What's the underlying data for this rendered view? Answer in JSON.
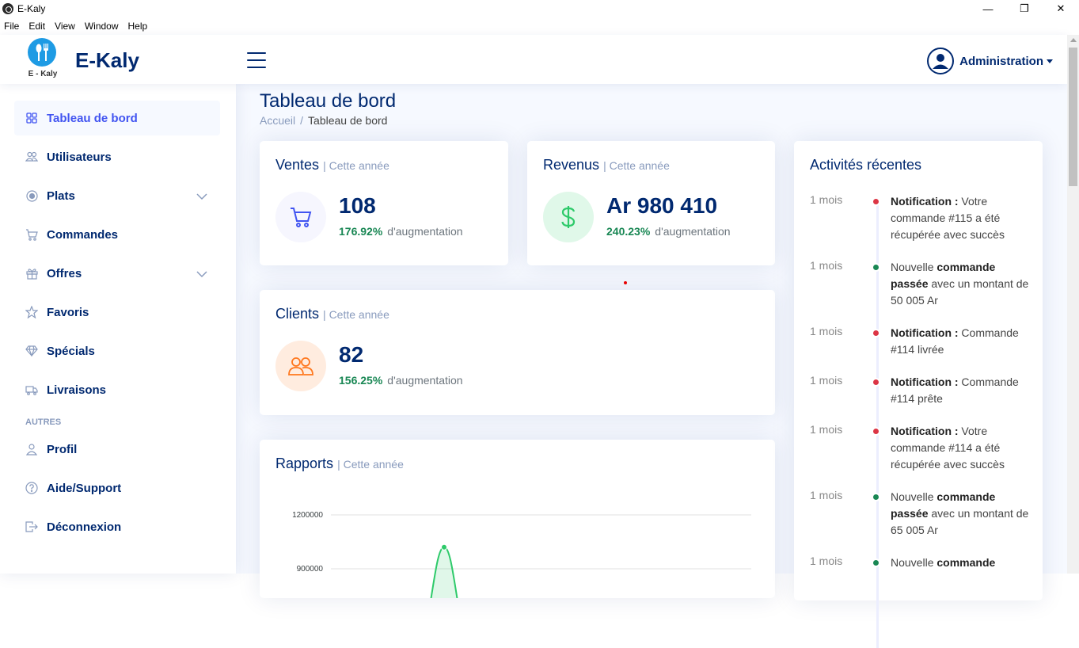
{
  "window": {
    "title": "E-Kaly",
    "controls": {
      "minimize": "—",
      "maximize": "❐",
      "close": "✕"
    }
  },
  "menu": [
    "File",
    "Edit",
    "View",
    "Window",
    "Help"
  ],
  "header": {
    "logo_text": "E - Kaly",
    "brand": "E-Kaly",
    "user_label": "Administration"
  },
  "sidebar": {
    "items": [
      {
        "label": "Tableau de bord",
        "icon": "grid-icon",
        "active": true
      },
      {
        "label": "Utilisateurs",
        "icon": "people-icon"
      },
      {
        "label": "Plats",
        "icon": "record-circle-icon",
        "expandable": true
      },
      {
        "label": "Commandes",
        "icon": "cart-icon"
      },
      {
        "label": "Offres",
        "icon": "gift-icon",
        "expandable": true
      },
      {
        "label": "Favoris",
        "icon": "star-icon"
      },
      {
        "label": "Spécials",
        "icon": "gem-icon"
      },
      {
        "label": "Livraisons",
        "icon": "truck-icon"
      }
    ],
    "heading": "AUTRES",
    "other_items": [
      {
        "label": "Profil",
        "icon": "person-icon"
      },
      {
        "label": "Aide/Support",
        "icon": "question-circle-icon"
      },
      {
        "label": "Déconnexion",
        "icon": "box-arrow-right-icon"
      }
    ]
  },
  "main": {
    "page_title": "Tableau de bord",
    "breadcrumb": {
      "home": "Accueil",
      "separator": "/",
      "current": "Tableau de bord"
    },
    "cards": {
      "ventes": {
        "title": "Ventes",
        "period": "| Cette année",
        "value": "108",
        "pct": "176.92%",
        "word": "d'augmentation",
        "icon": "cart-icon",
        "color": "#4154f1",
        "bg": "#f6f6fe"
      },
      "revenus": {
        "title": "Revenus",
        "period": "| Cette année",
        "value": "Ar 980 410",
        "pct": "240.23%",
        "word": "d'augmentation",
        "icon": "currency-dollar-icon",
        "color": "#2eca6a",
        "bg": "#e0f8e9"
      },
      "clients": {
        "title": "Clients",
        "period": "| Cette année",
        "value": "82",
        "pct": "156.25%",
        "word": "d'augmentation",
        "icon": "people-icon",
        "color": "#ff771d",
        "bg": "#ffecdf"
      }
    },
    "rapports": {
      "title": "Rapports",
      "period": "| Cette année"
    },
    "activity": {
      "title": "Activités récentes",
      "items": [
        {
          "time": "1 mois",
          "color": "#dc3545",
          "bold": "Notification :",
          "text": " Votre commande #115 a été récupérée avec succès"
        },
        {
          "time": "1 mois",
          "color": "#198754",
          "pre": "Nouvelle ",
          "bold": "commande passée",
          "text": " avec un montant de 50 005 Ar"
        },
        {
          "time": "1 mois",
          "color": "#dc3545",
          "bold": "Notification :",
          "text": " Commande #114 livrée"
        },
        {
          "time": "1 mois",
          "color": "#dc3545",
          "bold": "Notification :",
          "text": " Commande #114 prête"
        },
        {
          "time": "1 mois",
          "color": "#dc3545",
          "bold": "Notification :",
          "text": " Votre commande #114 a été récupérée avec succès"
        },
        {
          "time": "1 mois",
          "color": "#198754",
          "pre": "Nouvelle ",
          "bold": "commande passée",
          "text": " avec un montant de 65 005 Ar"
        },
        {
          "time": "1 mois",
          "color": "#198754",
          "pre": "Nouvelle ",
          "bold": "commande",
          "text": ""
        }
      ]
    }
  },
  "chart_data": {
    "type": "area",
    "title": "Rapports",
    "yticks": [
      "1200000",
      "900000"
    ],
    "series": [
      {
        "peak_value": 1020000,
        "color": "#2eca6a"
      }
    ]
  }
}
